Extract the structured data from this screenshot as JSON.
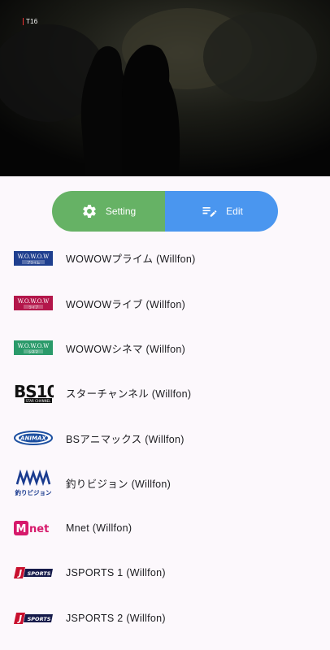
{
  "video": {
    "rating": "T16"
  },
  "toolbar": {
    "setting_label": "Setting",
    "edit_label": "Edit"
  },
  "channels": [
    {
      "label": "WOWOWプライム (Willfon)",
      "logo_text": "W.O.W.O.W",
      "logo_sub": "プライム",
      "logo_color": "#1f3f8f"
    },
    {
      "label": "WOWOWライブ (Willfon)",
      "logo_text": "W.O.W.O.W",
      "logo_sub": "ライブ",
      "logo_color": "#b3164a"
    },
    {
      "label": "WOWOWシネマ  (Willfon)",
      "logo_text": "W.O.W.O.W",
      "logo_sub": "シネマ",
      "logo_color": "#2a9a6a"
    },
    {
      "label": "スターチャンネル (Willfon)",
      "logo_text": "BS10",
      "logo_sub": "STAR CHANNEL",
      "logo_color": "#111111"
    },
    {
      "label": "BSアニマックス (Willfon)",
      "logo_text": "ANIMAX",
      "logo_color": "#1c4fa0"
    },
    {
      "label": "釣りビジョン (Willfon)",
      "logo_text": "釣りビジョン",
      "logo_color": "#1a3b8f"
    },
    {
      "label": "Mnet (Willfon)",
      "logo_text": "Mnet",
      "logo_color": "#d6196b"
    },
    {
      "label": "JSPORTS 1 (Willfon)",
      "logo_text": "JSPORTS",
      "logo_color": "#c8102e"
    },
    {
      "label": "JSPORTS 2 (Willfon)",
      "logo_text": "JSPORTS",
      "logo_color": "#c8102e"
    }
  ]
}
